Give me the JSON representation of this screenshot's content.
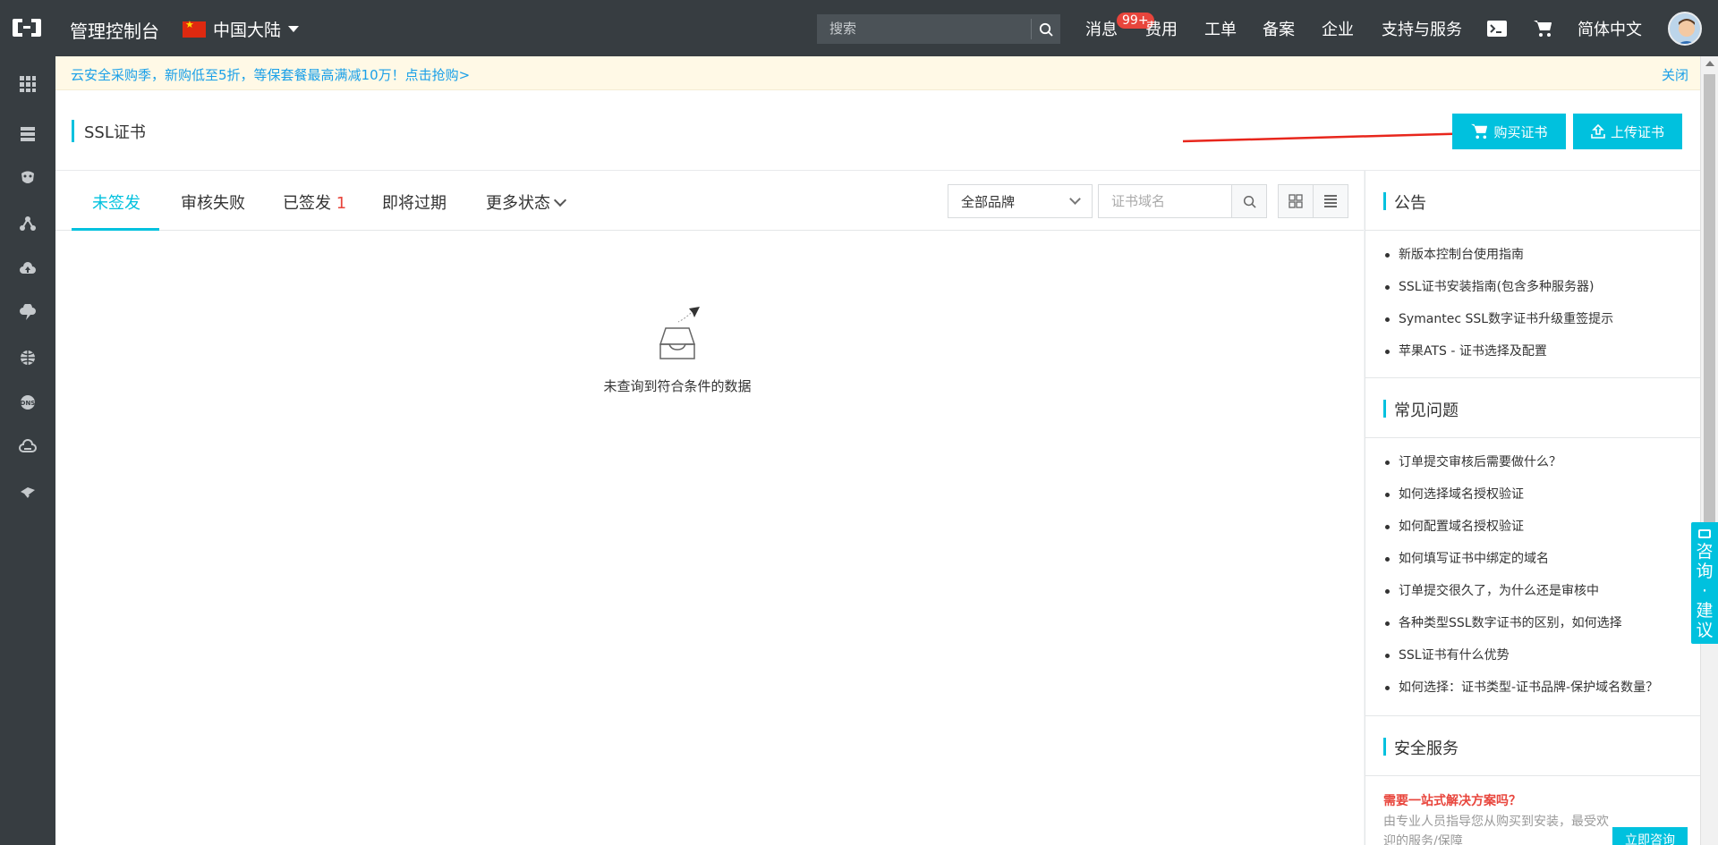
{
  "topbar": {
    "app_title": "管理控制台",
    "region": "中国大陆",
    "search_placeholder": "搜索",
    "badge": "99+",
    "nav": [
      "消息",
      "费用",
      "工单",
      "备案",
      "企业",
      "支持与服务",
      "简体中文"
    ]
  },
  "sidebar": {
    "icons": [
      "grid-icon",
      "server-icon",
      "database-icon",
      "network-icon",
      "cloud-icon",
      "cdn-icon",
      "globe-icon",
      "dns-icon",
      "cloud-storage-icon",
      "security-icon"
    ]
  },
  "notice": {
    "text": "云安全采购季，新购低至5折，等保套餐最高满减10万！点击抢购>",
    "close": "关闭"
  },
  "page": {
    "title": "SSL证书",
    "buy_button": "购买证书",
    "upload_button": "上传证书"
  },
  "tabs": {
    "unissued": "未签发",
    "review_failed": "审核失败",
    "issued": "已签发",
    "issued_count": "1",
    "expiring": "即将过期",
    "more": "更多状态"
  },
  "filters": {
    "brand_select": "全部品牌",
    "domain_placeholder": "证书域名"
  },
  "empty_state": {
    "message": "未查询到符合条件的数据"
  },
  "announcements": {
    "title": "公告",
    "items": [
      "新版本控制台使用指南",
      "SSL证书安装指南(包含多种服务器)",
      "Symantec SSL数字证书升级重签提示",
      "苹果ATS - 证书选择及配置"
    ]
  },
  "faq": {
    "title": "常见问题",
    "items": [
      "订单提交审核后需要做什么？",
      "如何选择域名授权验证",
      "如何配置域名授权验证",
      "如何填写证书中绑定的域名",
      "订单提交很久了，为什么还是审核中",
      "各种类型SSL数字证书的区别，如何选择",
      "SSL证书有什么优势",
      "如何选择：证书类型-证书品牌-保护域名数量？"
    ]
  },
  "security_service": {
    "title": "安全服务",
    "promo_title": "需要一站式解决方案吗？",
    "promo_desc": "由专业人员指导您从购买到安装，最受欢迎的服务/保障",
    "promo_button": "立即咨询"
  },
  "consult_float": {
    "label": "咨询·建议"
  },
  "colors": {
    "accent": "#00c1de",
    "topbar": "#373d41",
    "badge": "#e8453c",
    "link": "#1aa0e8"
  }
}
